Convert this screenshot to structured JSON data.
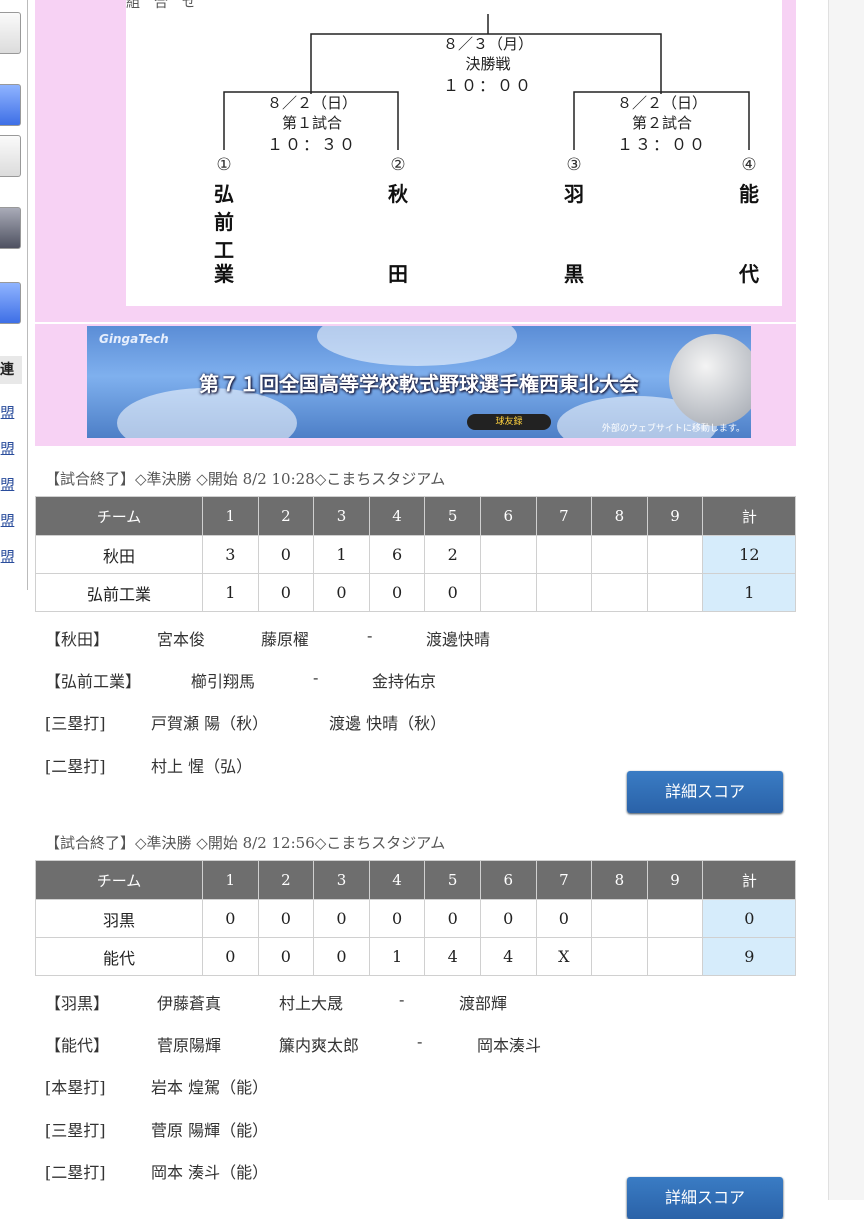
{
  "sidebar": {
    "league_label": "連盟",
    "link_labels": [
      "盟",
      "盟",
      "盟",
      "盟",
      "盟"
    ]
  },
  "bracket": {
    "top_label": "組　合　せ",
    "final": {
      "date": "８／３（月）",
      "name": "決勝戦",
      "time": "１０：００"
    },
    "semi1": {
      "date": "８／２（日）",
      "name": "第１試合",
      "time": "１０：３０"
    },
    "semi2": {
      "date": "８／２（日）",
      "name": "第２試合",
      "time": "１３：００"
    },
    "teams": [
      {
        "num": "①",
        "name": [
          "弘",
          "前",
          "工",
          "業"
        ]
      },
      {
        "num": "②",
        "name": [
          "秋",
          "",
          "",
          "田"
        ]
      },
      {
        "num": "③",
        "name": [
          "羽",
          "",
          "",
          "黒"
        ]
      },
      {
        "num": "④",
        "name": [
          "能",
          "",
          "",
          "代"
        ]
      }
    ]
  },
  "banner": {
    "brand": "GingaTech",
    "title": "第７１回全国高等学校軟式野球選手権西東北大会",
    "logo_text": "球友録",
    "note": "外部のウェブサイトに移動します。"
  },
  "games": [
    {
      "header": "【試合終了】◇準決勝 ◇開始 8/2 10:28◇こまちスタジアム",
      "columns": [
        "チーム",
        "1",
        "2",
        "3",
        "4",
        "5",
        "6",
        "7",
        "8",
        "9",
        "計"
      ],
      "rows": [
        {
          "team": "秋田",
          "innings": [
            "3",
            "0",
            "1",
            "6",
            "2",
            "",
            "",
            "",
            ""
          ],
          "total": "12"
        },
        {
          "team": "弘前工業",
          "innings": [
            "1",
            "0",
            "0",
            "0",
            "0",
            "",
            "",
            "",
            ""
          ],
          "total": "1"
        }
      ],
      "details": [
        {
          "label": "【秋田】",
          "items": [
            "宮本俊",
            "藤原櫂",
            "-",
            "渡邊快晴"
          ]
        },
        {
          "label": "【弘前工業】",
          "items": [
            "櫛引翔馬",
            "-",
            "金持佑京"
          ]
        },
        {
          "label": "[三塁打]",
          "items": [
            "戸賀瀬 陽（秋）",
            "渡邊 快晴（秋）"
          ]
        },
        {
          "label": "[二塁打]",
          "items": [
            "村上 惺（弘）"
          ]
        }
      ],
      "button": "詳細スコア"
    },
    {
      "header": "【試合終了】◇準決勝 ◇開始 8/2 12:56◇こまちスタジアム",
      "columns": [
        "チーム",
        "1",
        "2",
        "3",
        "4",
        "5",
        "6",
        "7",
        "8",
        "9",
        "計"
      ],
      "rows": [
        {
          "team": "羽黒",
          "innings": [
            "0",
            "0",
            "0",
            "0",
            "0",
            "0",
            "0",
            "",
            ""
          ],
          "total": "0"
        },
        {
          "team": "能代",
          "innings": [
            "0",
            "0",
            "0",
            "1",
            "4",
            "4",
            "X",
            "",
            ""
          ],
          "total": "9"
        }
      ],
      "details": [
        {
          "label": "【羽黒】",
          "items": [
            "伊藤蒼真",
            "村上大晟",
            "-",
            "渡部輝"
          ]
        },
        {
          "label": "【能代】",
          "items": [
            "菅原陽輝",
            "簾内爽太郎",
            "-",
            "岡本湊斗"
          ]
        },
        {
          "label": "[本塁打]",
          "items": [
            "岩本 煌駕（能）"
          ]
        },
        {
          "label": "[三塁打]",
          "items": [
            "菅原 陽輝（能）"
          ]
        },
        {
          "label": "[二塁打]",
          "items": [
            "岡本 湊斗（能）"
          ]
        }
      ],
      "button": "詳細スコア"
    }
  ]
}
